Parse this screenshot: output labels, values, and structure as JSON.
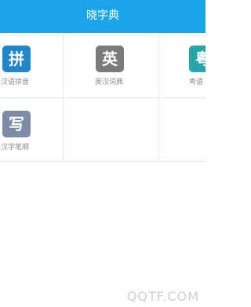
{
  "header": {
    "title": "晓字典",
    "bg_color": "#1ba5e8"
  },
  "grid": {
    "items": [
      {
        "icon_char": "拼",
        "label": "汉语拼音",
        "color": "#1f86cc"
      },
      {
        "icon_char": "英",
        "label": "英汉词典",
        "color": "#7a7a7a"
      },
      {
        "icon_char": "粤",
        "label": "粤语",
        "color": "#27a6a9"
      },
      {
        "icon_char": "写",
        "label": "汉字笔顺",
        "color": "#7d8ca6"
      }
    ]
  },
  "watermark": "QQTF.COM"
}
